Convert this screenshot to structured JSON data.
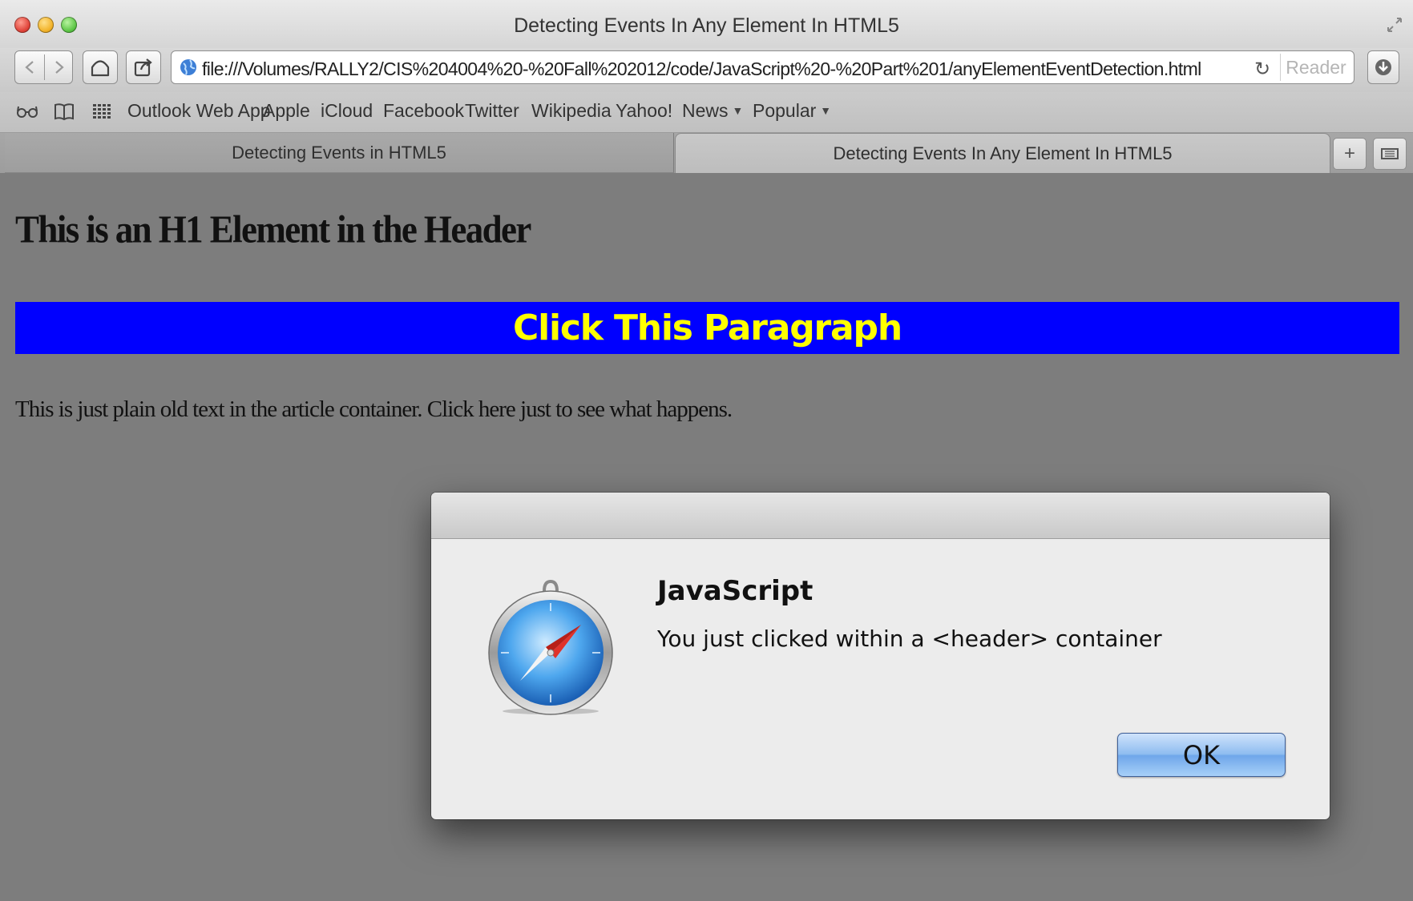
{
  "window": {
    "title": "Detecting Events In Any Element In HTML5"
  },
  "toolbar": {
    "url": "file:///Volumes/RALLY2/CIS%204004%20-%20Fall%202012/code/JavaScript%20-%20Part%201/anyElementEventDetection.html",
    "reader_label": "Reader"
  },
  "bookmarks": {
    "items": [
      {
        "label": "Outlook Web App"
      },
      {
        "label": "Apple"
      },
      {
        "label": "iCloud"
      },
      {
        "label": "Facebook"
      },
      {
        "label": "Twitter"
      },
      {
        "label": "Wikipedia"
      },
      {
        "label": "Yahoo!"
      },
      {
        "label": "News",
        "has_menu": true
      },
      {
        "label": "Popular",
        "has_menu": true
      }
    ]
  },
  "tabs": [
    {
      "label": "Detecting Events in HTML5",
      "active": false
    },
    {
      "label": "Detecting Events In Any Element In HTML5",
      "active": true
    }
  ],
  "page": {
    "h1": "This is an H1 Element in the Header",
    "paragraph": "Click This Paragraph",
    "article_text": "This is just plain old text in the article container. Click here just to see what happens.",
    "paragraph_bg": "#0000ff",
    "paragraph_fg": "#ffff00"
  },
  "dialog": {
    "title": "JavaScript",
    "message": "You just clicked within a <header> container",
    "ok_label": "OK",
    "icon": "safari-compass-icon"
  }
}
